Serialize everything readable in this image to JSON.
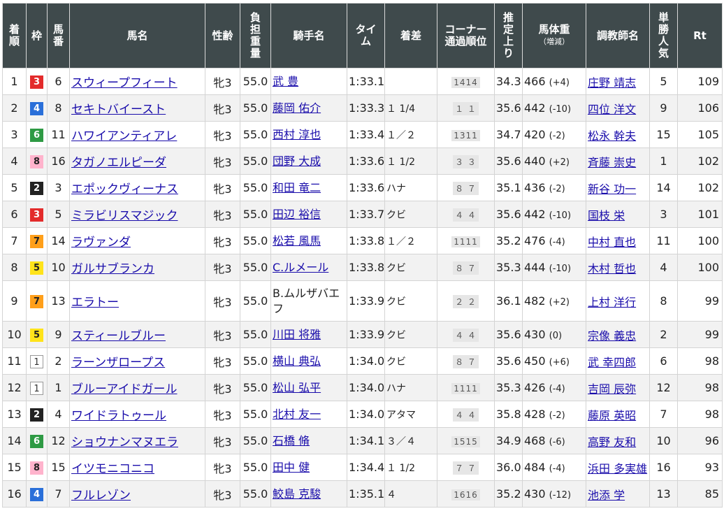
{
  "headers": [
    "着順",
    "枠",
    "馬番",
    "馬名",
    "性齢",
    "負担重量",
    "騎手名",
    "タイム",
    "着差",
    "コーナー通過順位",
    "推定上り",
    "馬体重",
    "調教師名",
    "単勝人気",
    "Rt"
  ],
  "header_multiline": {
    "rank": [
      "着",
      "順"
    ],
    "waku": [
      "枠"
    ],
    "umaban": [
      "馬",
      "番"
    ],
    "horse": [
      "馬名"
    ],
    "sexage": [
      "性齢"
    ],
    "weight": [
      "負",
      "担",
      "重",
      "量"
    ],
    "jockey": [
      "騎手名"
    ],
    "time": [
      "タイ",
      "ム"
    ],
    "margin": [
      "着差"
    ],
    "corner": [
      "コーナー",
      "通過順位"
    ],
    "last3f": [
      "推",
      "定",
      "上",
      "り"
    ],
    "bodyweight": [
      "馬体重"
    ],
    "bodyweight_sub": "（増減）",
    "trainer": [
      "調教師名"
    ],
    "popularity": [
      "単",
      "勝",
      "人",
      "気"
    ],
    "rt": [
      "Rt"
    ]
  },
  "colors": {
    "header_bg": "#3f4a4c",
    "link": "#1a0dab",
    "row_alt": "#f2f2f2",
    "waku": {
      "1": "#ffffff",
      "2": "#222222",
      "3": "#e32b2b",
      "4": "#2a6fd9",
      "5": "#ffe31a",
      "6": "#2e9a44",
      "7": "#ff9f1a",
      "8": "#ffb3cc"
    }
  },
  "rows": [
    {
      "rank": "1",
      "waku": "3",
      "umaban": "6",
      "horse": "スウィープフィート",
      "sexage": "牝3",
      "weight": "55.0",
      "jockey": "武 豊",
      "time": "1:33.1",
      "margin": "",
      "corner": "1414",
      "last3f": "34.3",
      "bw": "466",
      "bwdiff": "(+4)",
      "trainer": "庄野 靖志",
      "pop": "5",
      "rt": "109"
    },
    {
      "rank": "2",
      "waku": "4",
      "umaban": "8",
      "horse": "セキトバイースト",
      "sexage": "牝3",
      "weight": "55.0",
      "jockey": "藤岡 佑介",
      "time": "1:33.3",
      "margin": "１ 1/4",
      "corner": "１ １",
      "last3f": "35.6",
      "bw": "442",
      "bwdiff": "(-10)",
      "trainer": "四位 洋文",
      "pop": "9",
      "rt": "106"
    },
    {
      "rank": "3",
      "waku": "6",
      "umaban": "11",
      "horse": "ハワイアンティアレ",
      "sexage": "牝3",
      "weight": "55.0",
      "jockey": "西村 淳也",
      "time": "1:33.4",
      "margin": "１／２",
      "corner": "1311",
      "last3f": "34.7",
      "bw": "420",
      "bwdiff": "(-2)",
      "trainer": "松永 幹夫",
      "pop": "15",
      "rt": "105"
    },
    {
      "rank": "4",
      "waku": "8",
      "umaban": "16",
      "horse": "タガノエルピーダ",
      "sexage": "牝3",
      "weight": "55.0",
      "jockey": "団野 大成",
      "time": "1:33.6",
      "margin": "１ 1/2",
      "corner": "３ ３",
      "last3f": "35.6",
      "bw": "440",
      "bwdiff": "(+2)",
      "trainer": "斉藤 崇史",
      "pop": "1",
      "rt": "102"
    },
    {
      "rank": "5",
      "waku": "2",
      "umaban": "3",
      "horse": "エポックヴィーナス",
      "sexage": "牝3",
      "weight": "55.0",
      "jockey": "和田 竜二",
      "time": "1:33.6",
      "margin": "ハナ",
      "corner": "８ ７",
      "last3f": "35.1",
      "bw": "436",
      "bwdiff": "(-2)",
      "trainer": "新谷 功一",
      "pop": "14",
      "rt": "102"
    },
    {
      "rank": "6",
      "waku": "3",
      "umaban": "5",
      "horse": "ミラビリスマジック",
      "sexage": "牝3",
      "weight": "55.0",
      "jockey": "田辺 裕信",
      "time": "1:33.7",
      "margin": "クビ",
      "corner": "４ ４",
      "last3f": "35.6",
      "bw": "442",
      "bwdiff": "(-10)",
      "trainer": "国枝 栄",
      "pop": "3",
      "rt": "101"
    },
    {
      "rank": "7",
      "waku": "7",
      "umaban": "14",
      "horse": "ラヴァンダ",
      "sexage": "牝3",
      "weight": "55.0",
      "jockey": "松若 風馬",
      "time": "1:33.8",
      "margin": "１／２",
      "corner": "1111",
      "last3f": "35.2",
      "bw": "476",
      "bwdiff": "(-4)",
      "trainer": "中村 直也",
      "pop": "11",
      "rt": "100"
    },
    {
      "rank": "8",
      "waku": "5",
      "umaban": "10",
      "horse": "ガルサブランカ",
      "sexage": "牝3",
      "weight": "55.0",
      "jockey": "C.ルメール",
      "time": "1:33.8",
      "margin": "クビ",
      "corner": "８ ７",
      "last3f": "35.3",
      "bw": "444",
      "bwdiff": "(-10)",
      "trainer": "木村 哲也",
      "pop": "4",
      "rt": "100"
    },
    {
      "rank": "9",
      "waku": "7",
      "umaban": "13",
      "horse": "エラトー",
      "sexage": "牝3",
      "weight": "55.0",
      "jockey": "B.ムルザバエフ",
      "time": "1:33.9",
      "margin": "クビ",
      "corner": "２ ２",
      "last3f": "36.1",
      "bw": "482",
      "bwdiff": "(+2)",
      "trainer": "上村 洋行",
      "pop": "8",
      "rt": "99",
      "tall": true,
      "jockey_link": false
    },
    {
      "rank": "10",
      "waku": "5",
      "umaban": "9",
      "horse": "スティールブルー",
      "sexage": "牝3",
      "weight": "55.0",
      "jockey": "川田 将雅",
      "time": "1:33.9",
      "margin": "クビ",
      "corner": "４ ４",
      "last3f": "35.6",
      "bw": "430",
      "bwdiff": "(0)",
      "trainer": "宗像 義忠",
      "pop": "2",
      "rt": "99"
    },
    {
      "rank": "11",
      "waku": "1",
      "umaban": "2",
      "horse": "ラーンザロープス",
      "sexage": "牝3",
      "weight": "55.0",
      "jockey": "横山 典弘",
      "time": "1:34.0",
      "margin": "クビ",
      "corner": "８ ７",
      "last3f": "35.6",
      "bw": "450",
      "bwdiff": "(+6)",
      "trainer": "武 幸四郎",
      "pop": "6",
      "rt": "98"
    },
    {
      "rank": "12",
      "waku": "1",
      "umaban": "1",
      "horse": "ブルーアイドガール",
      "sexage": "牝3",
      "weight": "55.0",
      "jockey": "松山 弘平",
      "time": "1:34.0",
      "margin": "ハナ",
      "corner": "1111",
      "last3f": "35.3",
      "bw": "426",
      "bwdiff": "(-4)",
      "trainer": "吉岡 辰弥",
      "pop": "12",
      "rt": "98"
    },
    {
      "rank": "13",
      "waku": "2",
      "umaban": "4",
      "horse": "ワイドラトゥール",
      "sexage": "牝3",
      "weight": "55.0",
      "jockey": "北村 友一",
      "time": "1:34.0",
      "margin": "アタマ",
      "corner": "４ ４",
      "last3f": "35.8",
      "bw": "428",
      "bwdiff": "(-2)",
      "trainer": "藤原 英昭",
      "pop": "7",
      "rt": "98"
    },
    {
      "rank": "14",
      "waku": "6",
      "umaban": "12",
      "horse": "ショウナンマヌエラ",
      "sexage": "牝3",
      "weight": "55.0",
      "jockey": "石橋 脩",
      "time": "1:34.1",
      "margin": "３／４",
      "corner": "1515",
      "last3f": "34.9",
      "bw": "468",
      "bwdiff": "(-6)",
      "trainer": "高野 友和",
      "pop": "10",
      "rt": "96"
    },
    {
      "rank": "15",
      "waku": "8",
      "umaban": "15",
      "horse": "イツモニコニコ",
      "sexage": "牝3",
      "weight": "55.0",
      "jockey": "田中 健",
      "time": "1:34.4",
      "margin": "１ 1/2",
      "corner": "７ ７",
      "last3f": "36.0",
      "bw": "484",
      "bwdiff": "(-4)",
      "trainer": "浜田 多実雄",
      "pop": "16",
      "rt": "93"
    },
    {
      "rank": "16",
      "waku": "4",
      "umaban": "7",
      "horse": "フルレゾン",
      "sexage": "牝3",
      "weight": "55.0",
      "jockey": "鮫島 克駿",
      "time": "1:35.1",
      "margin": "４",
      "corner": "1616",
      "last3f": "35.2",
      "bw": "430",
      "bwdiff": "(-12)",
      "trainer": "池添 学",
      "pop": "13",
      "rt": "85"
    }
  ]
}
